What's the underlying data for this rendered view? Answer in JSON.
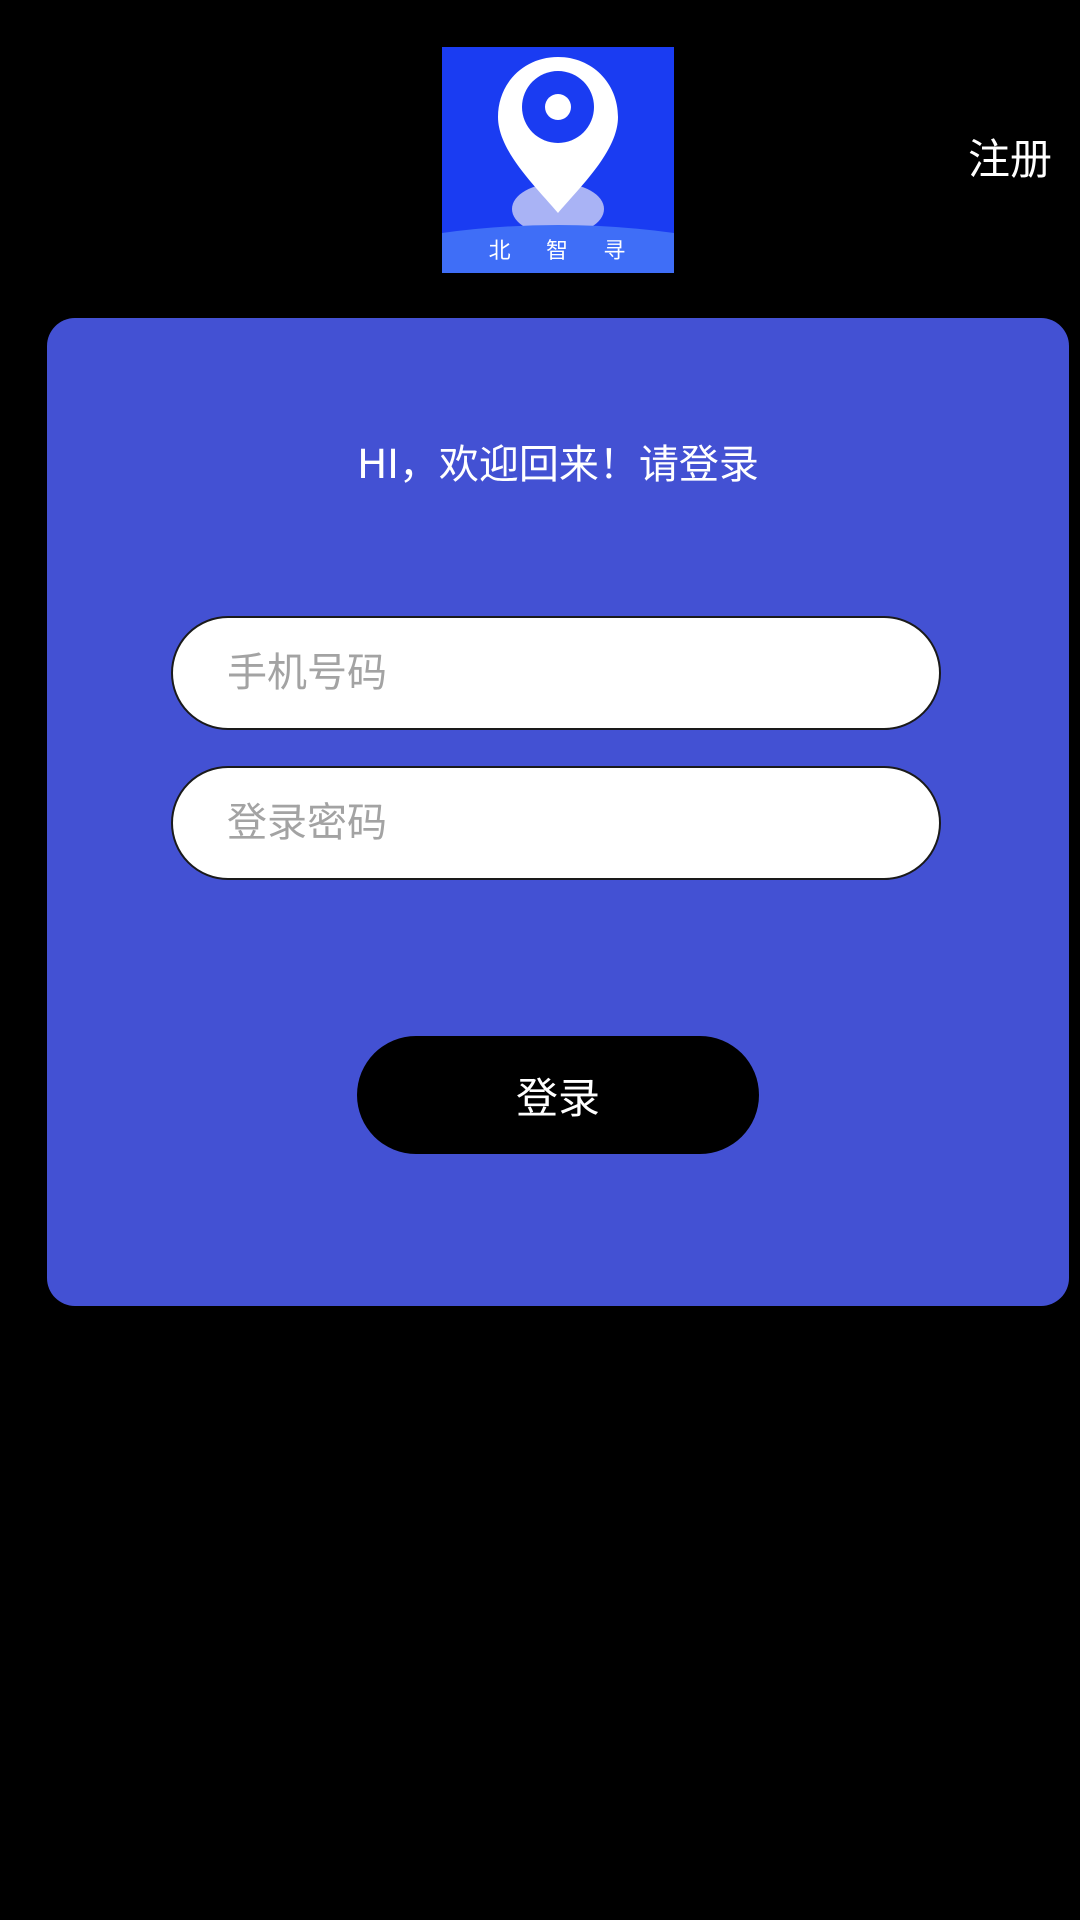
{
  "logo": {
    "icon": "location-pin-icon",
    "chars": [
      "北",
      "智",
      "寻"
    ],
    "background_color": "#1a3cf2"
  },
  "header": {
    "register_label": "注册"
  },
  "login_card": {
    "title": "HI，欢迎回来！请登录",
    "phone_placeholder": "手机号码",
    "phone_value": "",
    "password_placeholder": "登录密码",
    "password_value": "",
    "login_label": "登录",
    "background_color": "#4351d3"
  }
}
